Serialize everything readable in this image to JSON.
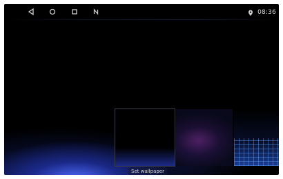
{
  "status_bar": {
    "nav": [
      "back-icon",
      "home-icon",
      "recents-icon",
      "notification-n-icon"
    ],
    "location_icon": "location-pin-icon",
    "time": "08:36"
  },
  "wallpaper_picker": {
    "set_wallpaper_label": "Set wallpaper",
    "thumbnails": [
      "black-blue-glow",
      "purple-haze",
      "blue-grid"
    ],
    "selected_index": 0
  },
  "colors": {
    "background": "#000000",
    "accent_glow": "#3f5bff"
  }
}
